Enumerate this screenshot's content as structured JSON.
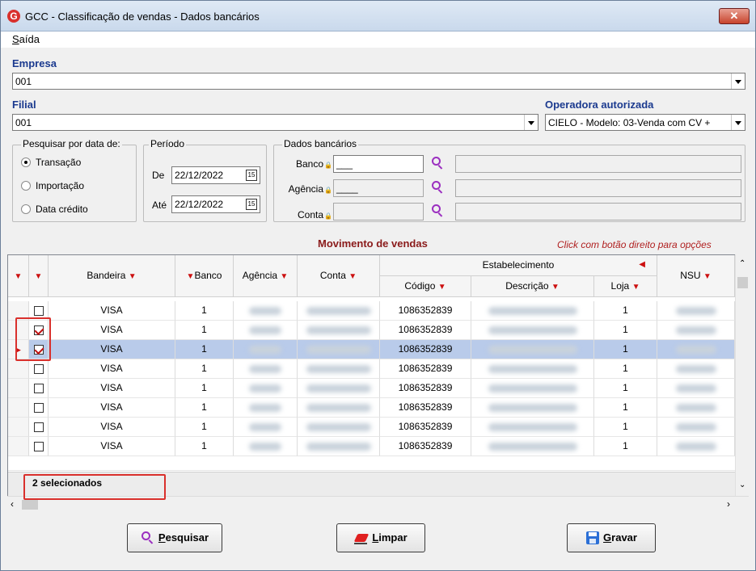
{
  "window": {
    "title": "GCC - Classificação de vendas - Dados bancários",
    "icon": "G",
    "close": "✕"
  },
  "menu": {
    "item": "Saída"
  },
  "empresa": {
    "label": "Empresa",
    "value": "001"
  },
  "filial": {
    "label": "Filial",
    "value": "001"
  },
  "operadora": {
    "label": "Operadora autorizada",
    "value": "CIELO - Modelo: 03-Venda com CV +"
  },
  "pesquisar": {
    "title": "Pesquisar por data de:",
    "options": [
      "Transação",
      "Importação",
      "Data crédito"
    ],
    "selected": "Transação"
  },
  "periodo": {
    "title": "Período",
    "de_label": "De",
    "de_value": "22/12/2022",
    "ate_label": "Até",
    "ate_value": "22/12/2022",
    "cal_icon": "15"
  },
  "dados_bancarios": {
    "title": "Dados bancários",
    "banco_label": "Banco",
    "agencia_label": "Agência",
    "conta_label": "Conta",
    "banco_value": "___",
    "agencia_value": "____"
  },
  "grid": {
    "caption": "Movimento de vendas",
    "hint": "Click com botão direito para opções",
    "headers": {
      "bandeira": "Bandeira",
      "banco": "Banco",
      "agencia": "Agência",
      "conta": "Conta",
      "estabelecimento": "Estabelecimento",
      "codigo": "Código",
      "descricao": "Descrição",
      "loja": "Loja",
      "nsu": "NSU"
    },
    "rows": [
      {
        "checked": false,
        "bandeira": "VISA",
        "banco": "1",
        "codigo": "1086352839",
        "loja": "1"
      },
      {
        "checked": true,
        "bandeira": "VISA",
        "banco": "1",
        "codigo": "1086352839",
        "loja": "1"
      },
      {
        "checked": true,
        "bandeira": "VISA",
        "banco": "1",
        "codigo": "1086352839",
        "loja": "1",
        "current": true
      },
      {
        "checked": false,
        "bandeira": "VISA",
        "banco": "1",
        "codigo": "1086352839",
        "loja": "1"
      },
      {
        "checked": false,
        "bandeira": "VISA",
        "banco": "1",
        "codigo": "1086352839",
        "loja": "1"
      },
      {
        "checked": false,
        "bandeira": "VISA",
        "banco": "1",
        "codigo": "1086352839",
        "loja": "1"
      },
      {
        "checked": false,
        "bandeira": "VISA",
        "banco": "1",
        "codigo": "1086352839",
        "loja": "1"
      },
      {
        "checked": false,
        "bandeira": "VISA",
        "banco": "1",
        "codigo": "1086352839",
        "loja": "1"
      }
    ],
    "footer": "2 selecionados"
  },
  "buttons": {
    "pesquisar": "Pesquisar",
    "limpar": "Limpar",
    "gravar": "Gravar"
  },
  "colors": {
    "label_blue": "#1b3a8f",
    "filter_red": "#cc1010",
    "selected_row": "#b9cbea",
    "highlight_rect": "#d9302c"
  }
}
